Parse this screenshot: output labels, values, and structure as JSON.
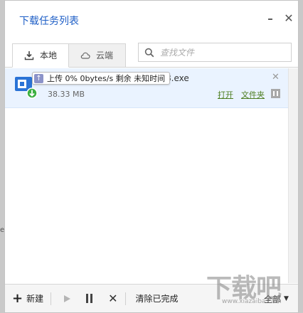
{
  "window": {
    "title": "下载任务列表",
    "minimize_glyph": "–",
    "close_glyph": "✕"
  },
  "tabs": [
    {
      "label": "本地",
      "icon": "download-icon",
      "active": true
    },
    {
      "label": "云端",
      "icon": "cloud-icon",
      "active": false
    }
  ],
  "search": {
    "placeholder": "查找文件",
    "value": ""
  },
  "tasks": [
    {
      "name_visible": "8.exe",
      "size": "38.33 MB",
      "tooltip": "上传 0% 0bytes/s 剩余 未知时间",
      "open_label": "打开",
      "folder_label": "文件夹",
      "close_glyph": "✕"
    }
  ],
  "toolbar": {
    "new_label": "新建",
    "clear_label": "清除已完成",
    "filter_label": "全部",
    "delete_glyph": "✕"
  },
  "watermark": {
    "text": "下载吧",
    "sub": "www.xiazaiba.com"
  },
  "edge_char": "e",
  "colors": {
    "title": "#1d5ec6",
    "row_highlight": "#eaf3ff",
    "link": "#4c7d1f"
  }
}
